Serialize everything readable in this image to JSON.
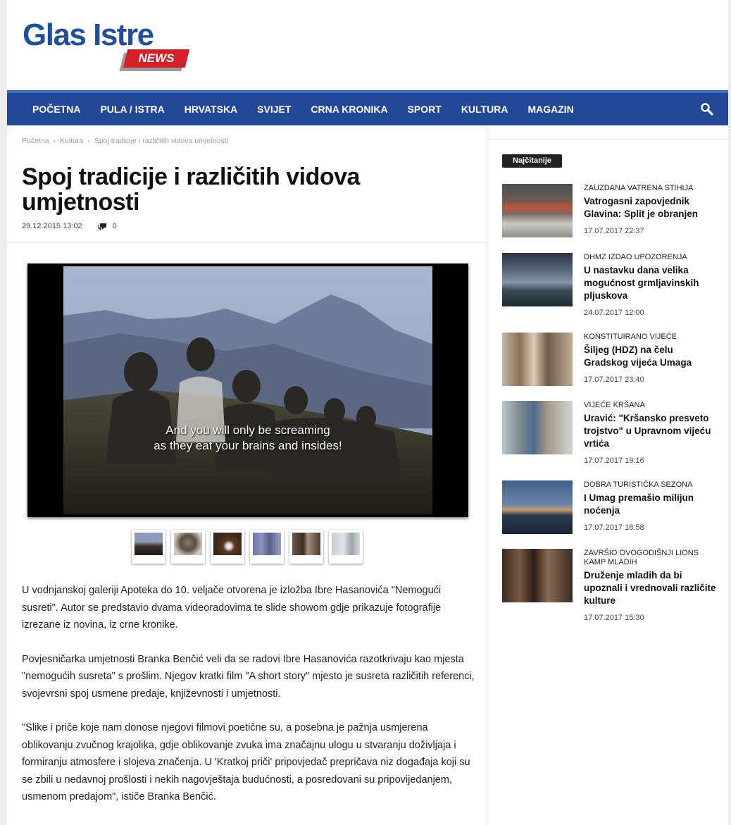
{
  "brand": {
    "name": "Glas Istre",
    "sub": "NEWS"
  },
  "nav": {
    "items": [
      "POČETNA",
      "PULA / ISTRA",
      "HRVATSKA",
      "SVIJET",
      "CRNA KRONIKA",
      "SPORT",
      "KULTURA",
      "MAGAZIN"
    ],
    "search_icon": "search-icon"
  },
  "breadcrumb": {
    "home": "Početna",
    "section": "Kultura",
    "current": "Spoj tradicije i različitih vidova umjetnosti"
  },
  "article": {
    "title": "Spoj tradicije i različitih vidova umjetnosti",
    "date": "29.12.2015 13:02",
    "comments": "0",
    "subtitle_line1": "And you will only be screaming",
    "subtitle_line2": "as they eat your brains and insides!",
    "paragraphs": [
      "U vodnjanskoj galeriji Apoteka do 10. veljače otvorena je izložba Ibre Hasanovića \"Nemogući susreti\". Autor se predstavio dvama videoradovima te slide showom gdje prikazuje fotografije izrezane iz novina, iz crne kronike.",
      "Povjesničarka umjetnosti Branka Benčić veli da se radovi Ibre Hasanovića razotkrivaju kao mjesta \"nemogućih susreta\" s prošlim. Njegov kratki film \"A short story\" mjesto je susreta različitih referenci, svojevrsni spoj usmene predaje, književnosti i umjetnosti.",
      "\"Slike i priče koje nam donose njegovi filmovi poetične su, a posebna je pažnja usmjerena oblikovanju zvučnog krajolika, gdje oblikovanje zvuka ima značajnu ulogu u stvaranju doživljaja i formiranju atmosfere i slojeva značenja. U 'Kratkoj priči' pripovjedač prepričava niz događaja koji su se zbili u nedavnoj prošlosti i nekih nagovještaja budućnosti, a posredovani su pripovijedanjem, usmenom predajom\", ističe Branka Benčić."
    ]
  },
  "sidebar": {
    "badge": "Najčitanije",
    "articles": [
      {
        "category": "ZAUZDANA VATRENA STIHIJA",
        "title": "Vatrogasni zapovjednik Glavina: Split je obranjen",
        "date": "17.07.2017 22:37"
      },
      {
        "category": "DHMZ IZDAO UPOZORENJA",
        "title": "U nastavku dana velika mogućnost grmljavinskih pljuskova",
        "date": "24.07.2017 12:00"
      },
      {
        "category": "KONSTITUIRANO VIJEĆE",
        "title": "Šiljeg (HDZ) na čelu Gradskog vijeća Umaga",
        "date": "17.07.2017 23:40"
      },
      {
        "category": "VIJEĆE KRŠANA",
        "title": "Uravić: \"Kršansko presveto trojstvo\" u Upravnom vijeću vrtića",
        "date": "17.07.2017 19:16"
      },
      {
        "category": "DOBRA TURISTIČKA SEZONA",
        "title": "I Umag premašio milijun noćenja",
        "date": "17.07.2017 18:58"
      },
      {
        "category": "ZAVRŠIO OVOGODIŠNJI LIONS KAMP MLADIH",
        "title": "Druženje mladih da bi upoznali i vrednovali različite kulture",
        "date": "17.07.2017 15:30"
      }
    ]
  }
}
